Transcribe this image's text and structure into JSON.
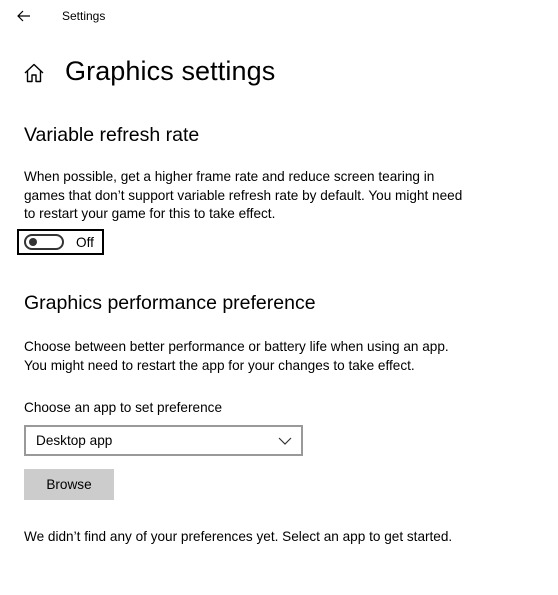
{
  "window": {
    "app_title": "Settings"
  },
  "header": {
    "page_title": "Graphics settings"
  },
  "variable_refresh": {
    "title": "Variable refresh rate",
    "description": "When possible, get a higher frame rate and reduce screen tearing in games that don’t support variable refresh rate by default. You might need to restart your game for this to take effect.",
    "toggle_state": "Off"
  },
  "performance": {
    "title": "Graphics performance preference",
    "description": "Choose between better performance or battery life when using an app. You might need to restart the app for your changes to take effect.",
    "dropdown_label": "Choose an app to set preference",
    "dropdown_value": "Desktop app",
    "browse_label": "Browse",
    "empty_note": "We didn’t find any of your preferences yet. Select an app to get started."
  },
  "icons": {
    "back": "back-arrow-icon",
    "home": "home-icon",
    "chevron": "chevron-down-icon"
  }
}
